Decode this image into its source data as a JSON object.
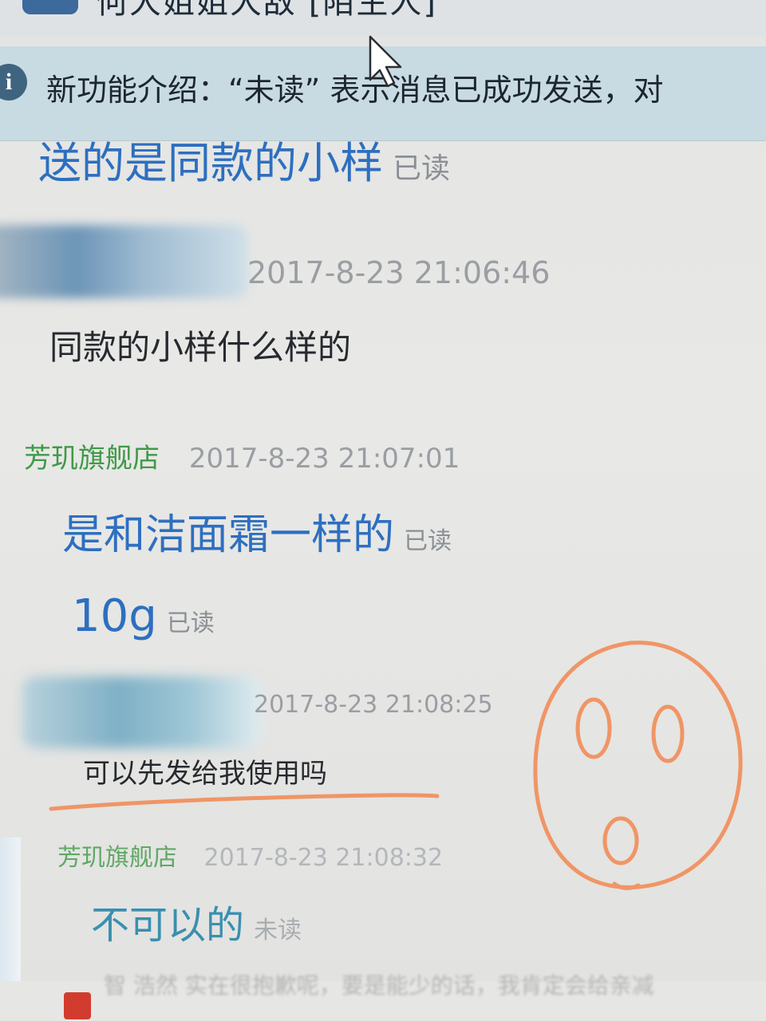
{
  "window": {
    "title": "何大姐姐大敌 [陌生人]"
  },
  "notice": {
    "text": "新功能介绍：“未读” 表示消息已成功发送，对"
  },
  "messages": [
    {
      "kind": "shop-text",
      "text": "送的是同款的小样",
      "status": "已读"
    },
    {
      "kind": "customer-header",
      "timestamp": "2017-8-23 21:06:46"
    },
    {
      "kind": "customer-text",
      "text": "同款的小样什么样的"
    },
    {
      "kind": "shop-header",
      "sender": "芳玑旗舰店",
      "timestamp": "2017-8-23 21:07:01"
    },
    {
      "kind": "shop-text",
      "text": "是和洁面霜一样的",
      "status": "已读"
    },
    {
      "kind": "shop-text",
      "text": "10g",
      "status": "已读"
    },
    {
      "kind": "customer-header",
      "timestamp": "2017-8-23 21:08:25"
    },
    {
      "kind": "customer-text",
      "text": "可以先发给我使用吗"
    },
    {
      "kind": "shop-header",
      "sender": "芳玑旗舰店",
      "timestamp": "2017-8-23 21:08:32"
    },
    {
      "kind": "shop-text",
      "text": "不可以的",
      "status": "未读"
    }
  ],
  "bottom": {
    "text": "智 浩然 实在很抱歉呢，要是能少的话，我肯定会给亲减"
  },
  "colors": {
    "shop_text": "#2d6fc0",
    "shop_name": "#3f9a48",
    "annotation": "#f09566",
    "notice_bg": "#c9dbe2"
  }
}
